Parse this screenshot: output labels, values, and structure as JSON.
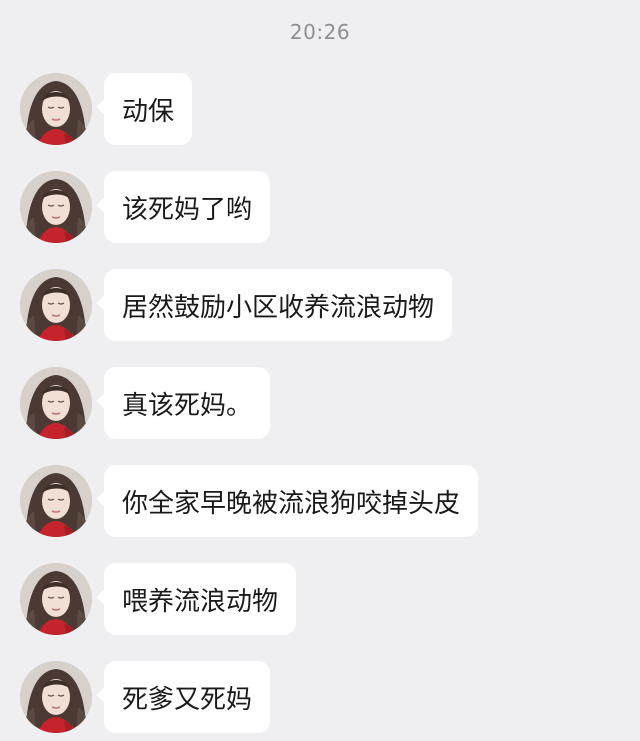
{
  "timestamp": "20:26",
  "avatar_icon": "user-avatar-photo",
  "colors": {
    "background": "#efeff1",
    "bubble": "#ffffff",
    "timestamp_text": "#8e8e93"
  },
  "messages": [
    {
      "text": "动保"
    },
    {
      "text": "该死妈了哟"
    },
    {
      "text": "居然鼓励小区收养流浪动物"
    },
    {
      "text": "真该死妈。"
    },
    {
      "text": "你全家早晚被流浪狗咬掉头皮"
    },
    {
      "text": "喂养流浪动物"
    },
    {
      "text": "死爹又死妈"
    }
  ]
}
